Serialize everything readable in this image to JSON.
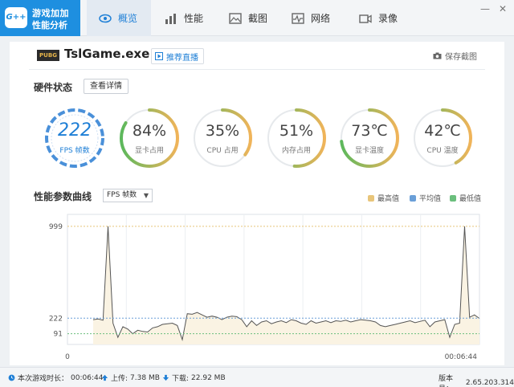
{
  "app": {
    "logo_badge": "G++",
    "logo_line1": "游戏加加",
    "logo_line2": "性能分析"
  },
  "tabs": [
    {
      "label": "概览",
      "icon": "eye-icon",
      "active": true
    },
    {
      "label": "性能",
      "icon": "bar-chart-icon",
      "active": false
    },
    {
      "label": "截图",
      "icon": "image-icon",
      "active": false
    },
    {
      "label": "网络",
      "icon": "pulse-icon",
      "active": false
    },
    {
      "label": "录像",
      "icon": "video-icon",
      "active": false
    }
  ],
  "window_controls": {
    "minimize": "—",
    "close": "✕"
  },
  "game": {
    "icon_text": "PUBG",
    "title": "TslGame.exe",
    "push_live": "推荐直播",
    "save_screenshot": "保存截图"
  },
  "hardware": {
    "title": "硬件状态",
    "detail_button": "查看详情",
    "fps": {
      "value": "222",
      "label": "FPS 帧数"
    },
    "gauges": [
      {
        "value": "84%",
        "label": "显卡占用",
        "fraction": 0.84
      },
      {
        "value": "35%",
        "label": "CPU 占用",
        "fraction": 0.35
      },
      {
        "value": "51%",
        "label": "内存占用",
        "fraction": 0.51
      },
      {
        "value": "73℃",
        "label": "显卡温度",
        "fraction": 0.73
      },
      {
        "value": "42℃",
        "label": "CPU 温度",
        "fraction": 0.42
      }
    ]
  },
  "colors": {
    "accent": "#1e7fd6",
    "gauge_start": "#f0b45a",
    "gauge_end": "#5cb85c",
    "max_color": "#e8c57a",
    "avg_color": "#6a9fd8",
    "min_color": "#6bbf7d"
  },
  "performance": {
    "title": "性能参数曲线",
    "select_value": "FPS 帧数",
    "legend": [
      {
        "label": "最高值",
        "color": "#e8c57a"
      },
      {
        "label": "平均值",
        "color": "#6a9fd8"
      },
      {
        "label": "最低值",
        "color": "#6bbf7d"
      }
    ]
  },
  "chart_data": {
    "type": "line",
    "ylim": [
      0,
      1100
    ],
    "yticks": [
      "999",
      "222",
      "91"
    ],
    "max_value": 999,
    "avg_value": 222,
    "min_value": 91,
    "x_start_label": "0",
    "x_end_label": "00:06:44",
    "values": [
      210,
      215,
      205,
      999,
      180,
      60,
      150,
      130,
      90,
      120,
      110,
      105,
      140,
      150,
      170,
      175,
      180,
      160,
      40,
      260,
      255,
      270,
      250,
      230,
      240,
      230,
      210,
      230,
      240,
      235,
      210,
      150,
      200,
      160,
      190,
      200,
      175,
      190,
      200,
      185,
      210,
      200,
      180,
      170,
      200,
      180,
      190,
      200,
      185,
      200,
      195,
      205,
      190,
      200,
      210,
      205,
      200,
      190,
      160,
      150,
      160,
      170,
      180,
      190,
      200,
      185,
      195,
      205,
      150,
      190,
      200,
      210,
      60,
      170,
      180,
      999,
      230,
      250,
      220
    ]
  },
  "status": {
    "duration_label": "本次游戏时长：",
    "duration_value": "00:06:44",
    "upload_label": "上传:",
    "upload_value": "7.38 MB",
    "download_label": "下载:",
    "download_value": "22.92 MB",
    "version_label": "版本号：",
    "version_value": "2.65.203.314"
  }
}
